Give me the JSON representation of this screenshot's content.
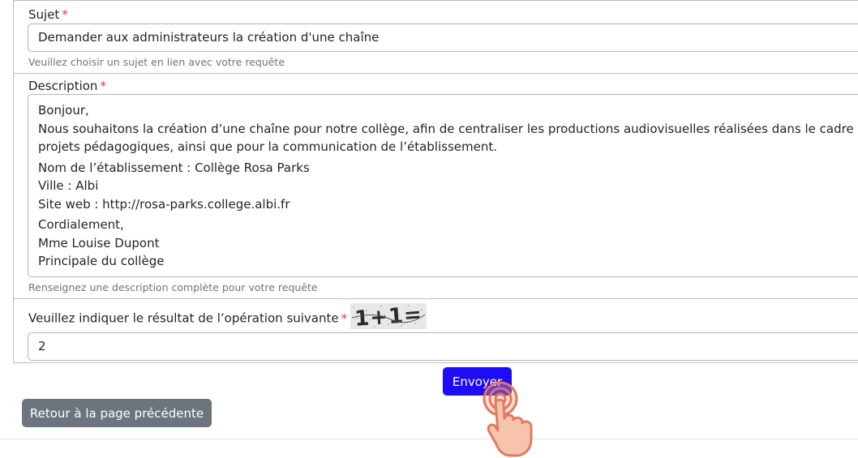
{
  "form": {
    "subject": {
      "label": "Sujet",
      "required_mark": "*",
      "value": "Demander aux administrateurs la création d'une chaîne",
      "help": "Veuillez choisir un sujet en lien avec votre requête"
    },
    "description": {
      "label": "Description",
      "required_mark": "*",
      "lines": [
        "Bonjour,",
        "Nous souhaitons la création d’une chaîne pour notre collège, afin de centraliser les productions audiovisuelles réalisées dans le cadre de",
        "projets pédagogiques, ainsi que pour la communication de l’établissement.",
        "Nom de l’établissement : Collège Rosa Parks",
        "Ville : Albi",
        "Site web : http://rosa-parks.college.albi.fr",
        "Cordialement,",
        "Mme Louise Dupont",
        "Principale du collège"
      ],
      "help": "Renseignez une description complète pour votre requête"
    },
    "captcha": {
      "label": "Veuillez indiquer le résultat de l’opération suivante",
      "required_mark": "*",
      "image_text": "1+1=",
      "value": "2"
    }
  },
  "buttons": {
    "send": "Envoyer",
    "back": "Retour à la page précédente"
  },
  "colors": {
    "send_button": "#1d0cf5",
    "back_button": "#6c757d",
    "required": "#dc3545",
    "help_text": "#6c757d"
  },
  "icons": {
    "cursor": "pointing-hand-click-icon"
  }
}
